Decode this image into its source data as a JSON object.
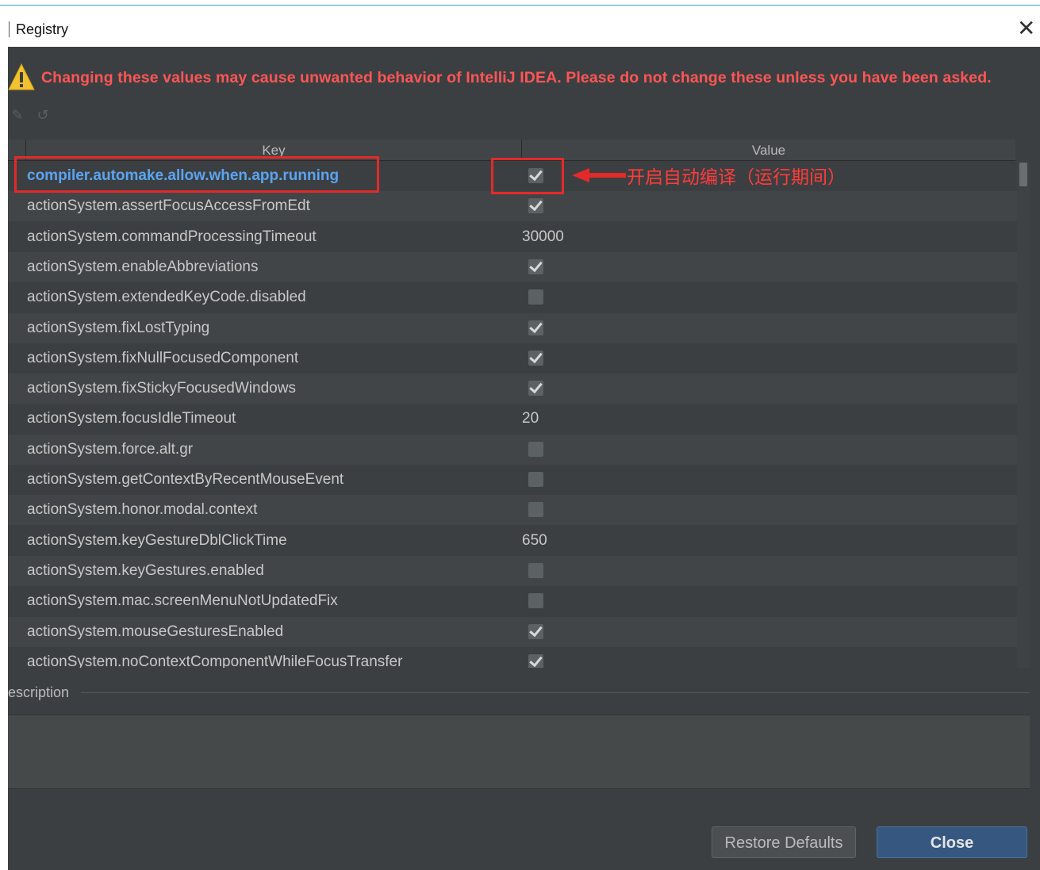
{
  "window": {
    "title": "Registry"
  },
  "warning": {
    "text": "Changing these values may cause unwanted behavior of IntelliJ IDEA. Please do not change these unless you have been asked."
  },
  "table": {
    "columns": [
      "Key",
      "Value"
    ],
    "rows": [
      {
        "key": "compiler.automake.allow.when.app.running",
        "type": "checkbox",
        "checked": true,
        "selected": true
      },
      {
        "key": "actionSystem.assertFocusAccessFromEdt",
        "type": "checkbox",
        "checked": true
      },
      {
        "key": "actionSystem.commandProcessingTimeout",
        "type": "text",
        "value": "30000"
      },
      {
        "key": "actionSystem.enableAbbreviations",
        "type": "checkbox",
        "checked": true
      },
      {
        "key": "actionSystem.extendedKeyCode.disabled",
        "type": "checkbox",
        "checked": false
      },
      {
        "key": "actionSystem.fixLostTyping",
        "type": "checkbox",
        "checked": true
      },
      {
        "key": "actionSystem.fixNullFocusedComponent",
        "type": "checkbox",
        "checked": true
      },
      {
        "key": "actionSystem.fixStickyFocusedWindows",
        "type": "checkbox",
        "checked": true
      },
      {
        "key": "actionSystem.focusIdleTimeout",
        "type": "text",
        "value": "20"
      },
      {
        "key": "actionSystem.force.alt.gr",
        "type": "checkbox",
        "checked": false
      },
      {
        "key": "actionSystem.getContextByRecentMouseEvent",
        "type": "checkbox",
        "checked": false
      },
      {
        "key": "actionSystem.honor.modal.context",
        "type": "checkbox",
        "checked": false
      },
      {
        "key": "actionSystem.keyGestureDblClickTime",
        "type": "text",
        "value": "650"
      },
      {
        "key": "actionSystem.keyGestures.enabled",
        "type": "checkbox",
        "checked": false
      },
      {
        "key": "actionSystem.mac.screenMenuNotUpdatedFix",
        "type": "checkbox",
        "checked": false
      },
      {
        "key": "actionSystem.mouseGesturesEnabled",
        "type": "checkbox",
        "checked": true
      },
      {
        "key": "actionSystem.noContextComponentWhileFocusTransfer",
        "type": "checkbox",
        "checked": true
      }
    ]
  },
  "annotation": {
    "text": "开启自动编译（运行期间）",
    "color": "#ff3b3b"
  },
  "description": {
    "label": "escription"
  },
  "buttons": {
    "restore": "Restore Defaults",
    "close": "Close"
  },
  "icons": {
    "close": "close-icon",
    "warning": "warning-icon",
    "edit": "edit-icon",
    "revert": "revert-icon"
  },
  "colors": {
    "warning_text": "#ff5555",
    "selected_key": "#5aa4f2",
    "dialog_bg": "#3c3f41",
    "close_button": "#365880"
  }
}
